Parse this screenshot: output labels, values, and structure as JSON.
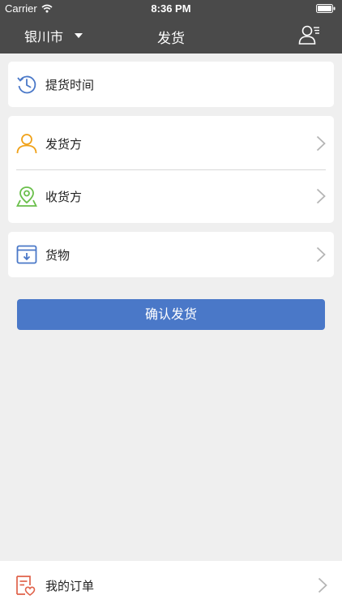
{
  "status_bar": {
    "carrier": "Carrier",
    "time": "8:36 PM"
  },
  "nav_bar": {
    "city": "银川市",
    "title": "发货"
  },
  "pickup_time": {
    "label": "提货时间",
    "icon": "clock-history-icon"
  },
  "parties": {
    "sender_label": "发货方",
    "sender_icon": "person-icon",
    "receiver_label": "收货方",
    "receiver_icon": "map-pin-icon"
  },
  "goods": {
    "label": "货物",
    "icon": "box-download-icon"
  },
  "confirm_button": {
    "label": "确认发货"
  },
  "bottom": {
    "my_orders_label": "我的订单",
    "icon": "order-heart-icon"
  },
  "colors": {
    "nav_background": "#4a4a4a",
    "primary_blue": "#4a78c8",
    "sender_orange": "#f0a21a",
    "receiver_green": "#6abf4b",
    "orders_red": "#e0624a",
    "page_background": "#efefef"
  }
}
